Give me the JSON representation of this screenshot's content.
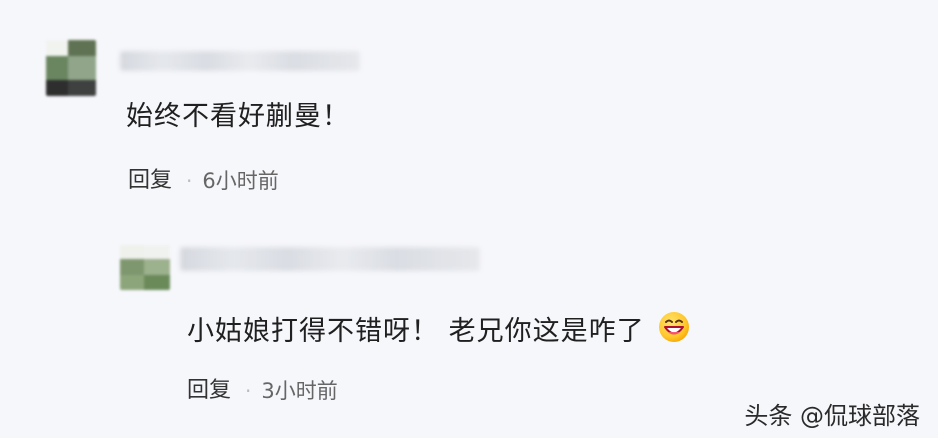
{
  "comments": [
    {
      "text": "始终不看好蒯曼！",
      "reply_label": "回复",
      "separator": "·",
      "time": "6小时前"
    },
    {
      "text": "小姑娘打得不错呀！ 老兄你这是咋了",
      "emoji": "laughing-face-icon",
      "reply_label": "回复",
      "separator": "·",
      "time": "3小时前"
    }
  ],
  "watermark": "头条 @侃球部落"
}
